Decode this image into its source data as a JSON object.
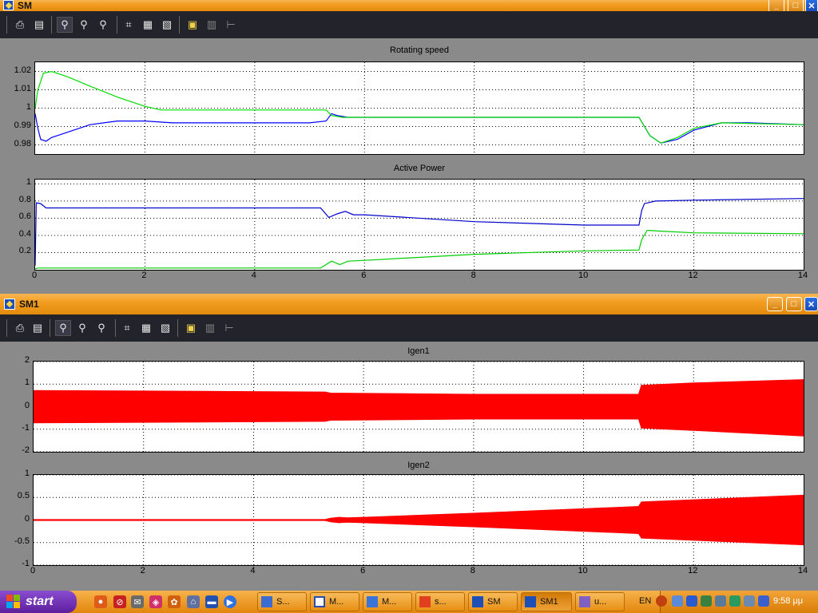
{
  "windows": [
    {
      "title": "SM",
      "plots": [
        {
          "title": "Rotating speed",
          "chart_data": {
            "type": "line",
            "title": "Rotating speed",
            "xlim": [
              0,
              14
            ],
            "ylim": [
              0.975,
              1.025
            ],
            "yticks": [
              "1.02",
              "1.01",
              "1",
              "0.99",
              "0.98"
            ],
            "xticks": [],
            "grid": true,
            "series": [
              {
                "color": "#0000ff",
                "x": [
                  0,
                  0.05,
                  0.1,
                  0.2,
                  0.3,
                  0.5,
                  1.0,
                  1.5,
                  2.0,
                  2.5,
                  5.0,
                  5.3,
                  5.4,
                  5.5,
                  5.7,
                  6.0,
                  8.0,
                  10.0,
                  11.0,
                  11.2,
                  11.4,
                  11.7,
                  12.0,
                  12.5,
                  13.0,
                  14.0
                ],
                "y": [
                  0.997,
                  0.989,
                  0.983,
                  0.982,
                  0.984,
                  0.986,
                  0.991,
                  0.993,
                  0.993,
                  0.992,
                  0.992,
                  0.993,
                  0.997,
                  0.996,
                  0.995,
                  0.995,
                  0.995,
                  0.995,
                  0.995,
                  0.985,
                  0.981,
                  0.983,
                  0.988,
                  0.992,
                  0.992,
                  0.991
                ]
              },
              {
                "color": "#00dd00",
                "x": [
                  0,
                  0.05,
                  0.15,
                  0.3,
                  0.6,
                  1.0,
                  1.5,
                  2.0,
                  2.3,
                  3.0,
                  5.3,
                  5.4,
                  5.6,
                  6.0,
                  8.0,
                  11.0,
                  11.2,
                  11.4,
                  11.7,
                  12.0,
                  12.5,
                  14.0
                ],
                "y": [
                  1.0,
                  1.01,
                  1.019,
                  1.02,
                  1.017,
                  1.012,
                  1.006,
                  1.001,
                  0.999,
                  0.999,
                  0.999,
                  0.996,
                  0.995,
                  0.995,
                  0.995,
                  0.995,
                  0.985,
                  0.981,
                  0.984,
                  0.989,
                  0.992,
                  0.991
                ]
              }
            ]
          }
        },
        {
          "title": "Active Power",
          "chart_data": {
            "type": "line",
            "title": "Active Power",
            "xlim": [
              0,
              14
            ],
            "ylim": [
              0,
              1.05
            ],
            "yticks": [
              "1",
              "0.8",
              "0.6",
              "0.4",
              "0.2"
            ],
            "xticks": [
              "0",
              "2",
              "4",
              "6",
              "8",
              "10",
              "12",
              "14"
            ],
            "grid": true,
            "series": [
              {
                "color": "#0000cc",
                "x": [
                  0,
                  0.02,
                  0.1,
                  0.2,
                  0.4,
                  1.0,
                  5.2,
                  5.35,
                  5.5,
                  5.65,
                  5.8,
                  6.0,
                  8.0,
                  10.0,
                  11.0,
                  11.05,
                  11.1,
                  11.3,
                  12.0,
                  14.0
                ],
                "y": [
                  0.05,
                  0.78,
                  0.77,
                  0.72,
                  0.72,
                  0.72,
                  0.72,
                  0.61,
                  0.65,
                  0.68,
                  0.64,
                  0.64,
                  0.56,
                  0.52,
                  0.52,
                  0.69,
                  0.77,
                  0.8,
                  0.81,
                  0.83
                ]
              },
              {
                "color": "#00cc00",
                "x": [
                  0,
                  0.05,
                  5.2,
                  5.4,
                  5.55,
                  5.7,
                  6.0,
                  8.0,
                  10.0,
                  11.0,
                  11.05,
                  11.15,
                  11.4,
                  12.0,
                  14.0
                ],
                "y": [
                  0.01,
                  0.02,
                  0.02,
                  0.1,
                  0.06,
                  0.1,
                  0.11,
                  0.18,
                  0.22,
                  0.23,
                  0.35,
                  0.46,
                  0.45,
                  0.43,
                  0.42
                ]
              }
            ]
          }
        }
      ]
    },
    {
      "title": "SM1",
      "plots": [
        {
          "title": "Igen1",
          "chart_data": {
            "type": "area",
            "title": "Igen1",
            "xlim": [
              0,
              14
            ],
            "ylim": [
              -2,
              2
            ],
            "yticks": [
              "2",
              "1",
              "0",
              "-1",
              "-2"
            ],
            "xticks": [],
            "grid": true,
            "envelope": {
              "color": "#ff0000",
              "x": [
                0,
                5.3,
                5.4,
                8.0,
                11.0,
                11.05,
                12.0,
                14.0
              ],
              "upper": [
                0.72,
                0.65,
                0.6,
                0.55,
                0.55,
                0.95,
                1.05,
                1.2
              ],
              "lower": [
                -0.72,
                -0.65,
                -0.6,
                -0.55,
                -0.55,
                -0.95,
                -1.05,
                -1.3
              ]
            }
          }
        },
        {
          "title": "Igen2",
          "chart_data": {
            "type": "area",
            "title": "Igen2",
            "xlim": [
              0,
              14
            ],
            "ylim": [
              -1,
              1
            ],
            "yticks": [
              "1",
              "0.5",
              "0",
              "-0.5",
              "-1"
            ],
            "xticks": [
              "0",
              "2",
              "4",
              "6",
              "8",
              "10",
              "12",
              "14"
            ],
            "grid": true,
            "envelope": {
              "color": "#ff0000",
              "x": [
                0,
                5.3,
                5.4,
                5.55,
                5.7,
                6.0,
                8.0,
                10.0,
                11.0,
                11.05,
                12.0,
                14.0
              ],
              "upper": [
                0.01,
                0.01,
                0.04,
                0.06,
                0.05,
                0.06,
                0.15,
                0.25,
                0.3,
                0.4,
                0.45,
                0.55
              ],
              "lower": [
                -0.01,
                -0.01,
                -0.04,
                -0.06,
                -0.05,
                -0.06,
                -0.15,
                -0.25,
                -0.3,
                -0.4,
                -0.45,
                -0.55
              ]
            }
          }
        }
      ]
    }
  ],
  "toolbar_icons": [
    "print-icon",
    "print-figure-icon",
    "zoom-icon",
    "zoom-x-icon",
    "zoom-y-icon",
    "binoculars-icon",
    "save-axes-icon",
    "restore-axes-icon",
    "floating-scope-icon",
    "lock-icon",
    "signal-selector-icon"
  ],
  "taskbar": {
    "start_label": "start",
    "tasks": [
      {
        "label": "S...",
        "icon": "folder-icon"
      },
      {
        "label": "M...",
        "icon": "word-icon"
      },
      {
        "label": "M...",
        "icon": "matlab-icon"
      },
      {
        "label": "s...",
        "icon": "simulink-icon"
      },
      {
        "label": "SM",
        "icon": "scope-icon"
      },
      {
        "label": "SM1",
        "icon": "scope-icon"
      },
      {
        "label": "u...",
        "icon": "app-icon"
      }
    ],
    "lang": "EN",
    "clock": "9:58 μμ"
  }
}
